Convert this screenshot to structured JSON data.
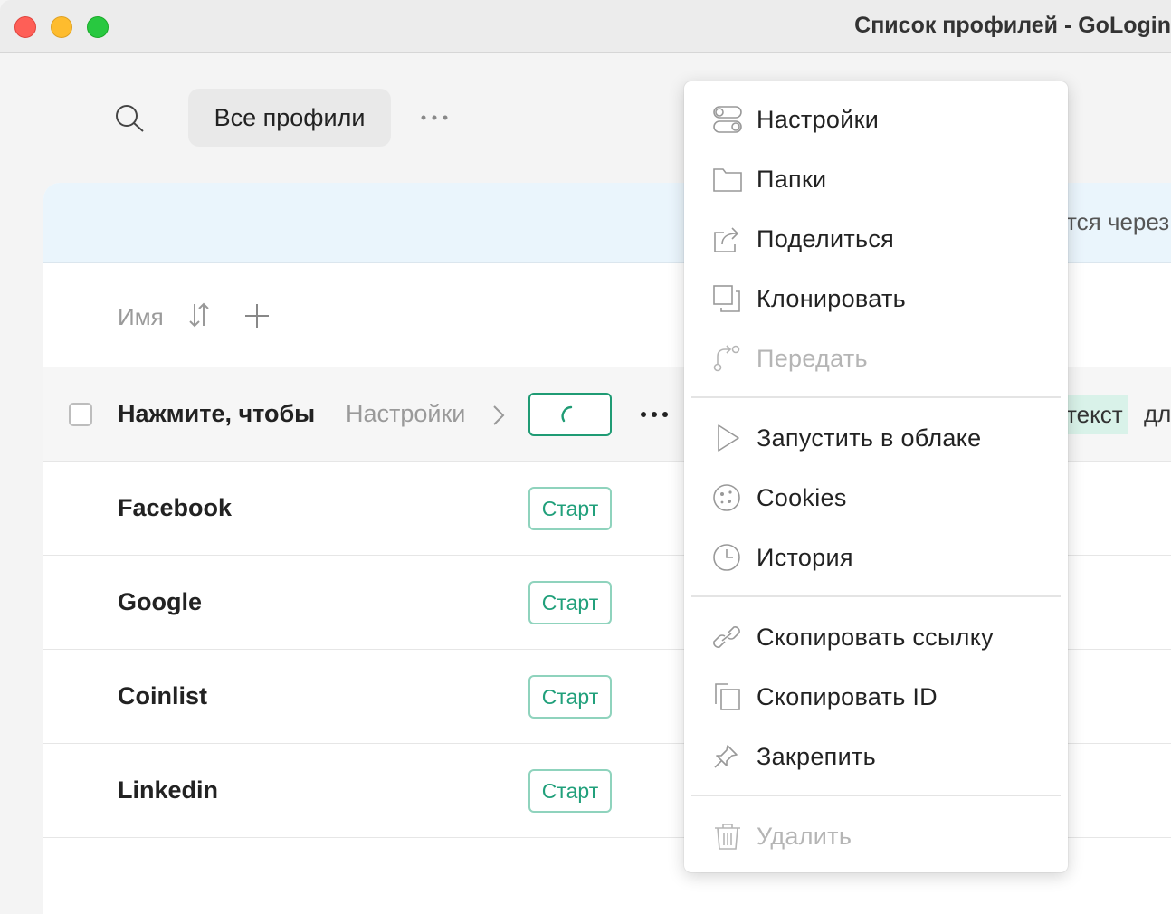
{
  "window": {
    "title": "Список профилей - GoLogin"
  },
  "toolbar": {
    "tab_all": "Все профили"
  },
  "banner": {
    "text_fragment": "тся через"
  },
  "table": {
    "column_name": "Имя",
    "rows": [
      {
        "name": "Нажмите, чтобы",
        "settings": "Настройки",
        "action": "",
        "loading": true,
        "tag": "текст",
        "tag_after": "дл"
      },
      {
        "name": "Facebook",
        "action": "Старт"
      },
      {
        "name": "Google",
        "action": "Старт"
      },
      {
        "name": "Coinlist",
        "action": "Старт"
      },
      {
        "name": "Linkedin",
        "action": "Старт"
      }
    ]
  },
  "menu": {
    "items": [
      {
        "label": "Настройки",
        "icon": "toggles-icon",
        "enabled": true
      },
      {
        "label": "Папки",
        "icon": "folder-icon",
        "enabled": true
      },
      {
        "label": "Поделиться",
        "icon": "share-icon",
        "enabled": true
      },
      {
        "label": "Клонировать",
        "icon": "clone-icon",
        "enabled": true
      },
      {
        "label": "Передать",
        "icon": "transfer-icon",
        "enabled": false
      },
      {
        "label": "Запустить в облаке",
        "icon": "play-icon",
        "enabled": true
      },
      {
        "label": "Cookies",
        "icon": "cookie-icon",
        "enabled": true
      },
      {
        "label": "История",
        "icon": "clock-icon",
        "enabled": true
      },
      {
        "label": "Скопировать ссылку",
        "icon": "link-icon",
        "enabled": true
      },
      {
        "label": "Скопировать ID",
        "icon": "copy-icon",
        "enabled": true
      },
      {
        "label": "Закрепить",
        "icon": "pin-icon",
        "enabled": true
      },
      {
        "label": "Удалить",
        "icon": "trash-icon",
        "enabled": false
      }
    ]
  },
  "colors": {
    "accent": "#21a07b",
    "accent_border": "#8fd3bd",
    "banner_bg": "#eaf5fc",
    "tag_bg": "#d9f2e9"
  }
}
